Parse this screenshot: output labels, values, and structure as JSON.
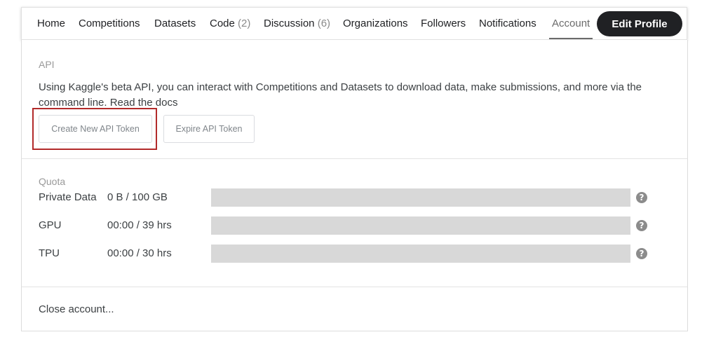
{
  "nav": {
    "tabs": [
      {
        "label": "Home",
        "count": ""
      },
      {
        "label": "Competitions",
        "count": ""
      },
      {
        "label": "Datasets",
        "count": ""
      },
      {
        "label": "Code",
        "count": "(2)"
      },
      {
        "label": "Discussion",
        "count": "(6)"
      },
      {
        "label": "Organizations",
        "count": ""
      },
      {
        "label": "Followers",
        "count": ""
      },
      {
        "label": "Notifications",
        "count": ""
      },
      {
        "label": "Account",
        "count": ""
      }
    ],
    "active_tab": "Account",
    "edit_profile_label": "Edit Profile"
  },
  "api": {
    "title": "API",
    "description": "Using Kaggle's beta API, you can interact with Competitions and Datasets to download data, make submissions, and more via the command line. Read the docs",
    "create_token_label": "Create New API Token",
    "expire_token_label": "Expire API Token"
  },
  "quota": {
    "title": "Quota",
    "rows": [
      {
        "label": "Private Data",
        "value": "0 B / 100 GB",
        "used_fraction": 0
      },
      {
        "label": "GPU",
        "value": "00:00 / 39 hrs",
        "used_fraction": 0
      },
      {
        "label": "TPU",
        "value": "00:00 / 30 hrs",
        "used_fraction": 0
      }
    ]
  },
  "close_account_label": "Close account...",
  "colors": {
    "highlight_border": "#b22a2a",
    "edit_profile_bg": "#202124",
    "quota_bar_bg": "#d8d8d8"
  },
  "icons": {
    "help": "question-circle-icon"
  }
}
